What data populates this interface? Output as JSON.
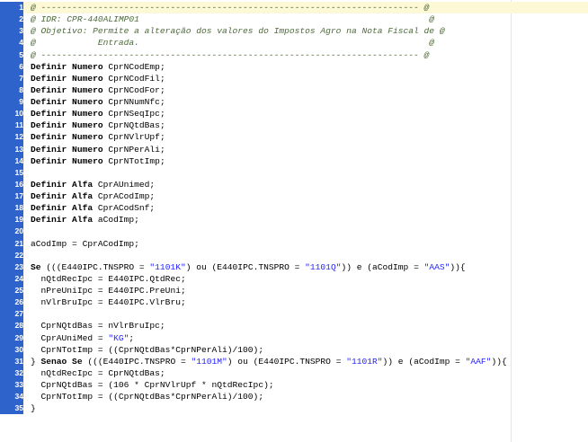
{
  "editor": {
    "lines": [
      {
        "n": "1",
        "segs": [
          {
            "t": "@ ------------------------------------------------------------------------- @",
            "c": "comment"
          }
        ]
      },
      {
        "n": "2",
        "segs": [
          {
            "t": "@ IDR: CPR-440ALIMP01                                                        @",
            "c": "comment"
          }
        ]
      },
      {
        "n": "3",
        "segs": [
          {
            "t": "@ Objetivo: Permite a alteração dos valores do Impostos Agro na Nota Fiscal de @",
            "c": "comment"
          }
        ]
      },
      {
        "n": "4",
        "segs": [
          {
            "t": "@            Entrada.                                                        @",
            "c": "comment"
          }
        ]
      },
      {
        "n": "5",
        "segs": [
          {
            "t": "@ ------------------------------------------------------------------------- @",
            "c": "comment"
          }
        ]
      },
      {
        "n": "6",
        "segs": [
          {
            "t": "Definir Numero",
            "c": "kw"
          },
          {
            "t": " CprNCodEmp;",
            "c": ""
          }
        ]
      },
      {
        "n": "7",
        "segs": [
          {
            "t": "Definir Numero",
            "c": "kw"
          },
          {
            "t": " CprNCodFil;",
            "c": ""
          }
        ]
      },
      {
        "n": "8",
        "segs": [
          {
            "t": "Definir Numero",
            "c": "kw"
          },
          {
            "t": " CprNCodFor;",
            "c": ""
          }
        ]
      },
      {
        "n": "9",
        "segs": [
          {
            "t": "Definir Numero",
            "c": "kw"
          },
          {
            "t": " CprNNumNfc;",
            "c": ""
          }
        ]
      },
      {
        "n": "10",
        "segs": [
          {
            "t": "Definir Numero",
            "c": "kw"
          },
          {
            "t": " CprNSeqIpc;",
            "c": ""
          }
        ]
      },
      {
        "n": "11",
        "segs": [
          {
            "t": "Definir Numero",
            "c": "kw"
          },
          {
            "t": " CprNQtdBas;",
            "c": ""
          }
        ]
      },
      {
        "n": "12",
        "segs": [
          {
            "t": "Definir Numero",
            "c": "kw"
          },
          {
            "t": " CprNVlrUpf;",
            "c": ""
          }
        ]
      },
      {
        "n": "13",
        "segs": [
          {
            "t": "Definir Numero",
            "c": "kw"
          },
          {
            "t": " CprNPerAli;",
            "c": ""
          }
        ]
      },
      {
        "n": "14",
        "segs": [
          {
            "t": "Definir Numero",
            "c": "kw"
          },
          {
            "t": " CprNTotImp;",
            "c": ""
          }
        ]
      },
      {
        "n": "15",
        "segs": []
      },
      {
        "n": "16",
        "segs": [
          {
            "t": "Definir Alfa",
            "c": "kw"
          },
          {
            "t": " CprAUnimed;",
            "c": ""
          }
        ]
      },
      {
        "n": "17",
        "segs": [
          {
            "t": "Definir Alfa",
            "c": "kw"
          },
          {
            "t": " CprACodImp;",
            "c": ""
          }
        ]
      },
      {
        "n": "18",
        "segs": [
          {
            "t": "Definir Alfa",
            "c": "kw"
          },
          {
            "t": " CprACodSnf;",
            "c": ""
          }
        ]
      },
      {
        "n": "19",
        "segs": [
          {
            "t": "Definir Alfa",
            "c": "kw"
          },
          {
            "t": " aCodImp;",
            "c": ""
          }
        ]
      },
      {
        "n": "20",
        "segs": []
      },
      {
        "n": "21",
        "segs": [
          {
            "t": "aCodImp = CprACodImp;",
            "c": ""
          }
        ]
      },
      {
        "n": "22",
        "segs": []
      },
      {
        "n": "23",
        "segs": [
          {
            "t": "Se",
            "c": "kw"
          },
          {
            "t": " (((E440IPC.TNSPRO = ",
            "c": ""
          },
          {
            "t": "\"1101K\"",
            "c": "str"
          },
          {
            "t": ") ou (E440IPC.TNSPRO = ",
            "c": ""
          },
          {
            "t": "\"1101Q\"",
            "c": "str"
          },
          {
            "t": ")) e (aCodImp = ",
            "c": ""
          },
          {
            "t": "\"AAS\"",
            "c": "str"
          },
          {
            "t": ")){",
            "c": ""
          }
        ]
      },
      {
        "n": "24",
        "segs": [
          {
            "t": "  nQtdRecIpc = E440IPC.QtdRec;",
            "c": ""
          }
        ]
      },
      {
        "n": "25",
        "segs": [
          {
            "t": "  nPreUniIpc = E440IPC.PreUni;",
            "c": ""
          }
        ]
      },
      {
        "n": "26",
        "segs": [
          {
            "t": "  nVlrBruIpc = E440IPC.VlrBru;",
            "c": ""
          }
        ]
      },
      {
        "n": "27",
        "segs": []
      },
      {
        "n": "28",
        "segs": [
          {
            "t": "  CprNQtdBas = nVlrBruIpc;",
            "c": ""
          }
        ]
      },
      {
        "n": "29",
        "segs": [
          {
            "t": "  CprAUniMed = ",
            "c": ""
          },
          {
            "t": "\"KG\"",
            "c": "str"
          },
          {
            "t": ";",
            "c": ""
          }
        ]
      },
      {
        "n": "30",
        "segs": [
          {
            "t": "  CprNTotImp = ((CprNQtdBas*CprNPerAli)/100);",
            "c": ""
          }
        ]
      },
      {
        "n": "31",
        "segs": [
          {
            "t": "} ",
            "c": ""
          },
          {
            "t": "Senao Se",
            "c": "kw"
          },
          {
            "t": " (((E440IPC.TNSPRO = ",
            "c": ""
          },
          {
            "t": "\"1101M\"",
            "c": "str"
          },
          {
            "t": ") ou (E440IPC.TNSPRO = ",
            "c": ""
          },
          {
            "t": "\"1101R\"",
            "c": "str"
          },
          {
            "t": ")) e (aCodImp = ",
            "c": ""
          },
          {
            "t": "\"AAF\"",
            "c": "str"
          },
          {
            "t": ")){",
            "c": ""
          }
        ]
      },
      {
        "n": "32",
        "segs": [
          {
            "t": "  nQtdRecIpc = CprNQtdBas;",
            "c": ""
          }
        ]
      },
      {
        "n": "33",
        "segs": [
          {
            "t": "  CprNQtdBas = (106 * CprNVlrUpf * nQtdRecIpc);",
            "c": ""
          }
        ]
      },
      {
        "n": "34",
        "segs": [
          {
            "t": "  CprNTotImp = ((CprNQtdBas*CprNPerAli)/100);",
            "c": ""
          }
        ]
      },
      {
        "n": "35",
        "segs": [
          {
            "t": "}",
            "c": ""
          }
        ]
      }
    ]
  },
  "colors": {
    "gutter": "#2f63cc",
    "comment": "#4d6a3a",
    "string": "#2222ff",
    "current_line": "#fdf8d6"
  }
}
